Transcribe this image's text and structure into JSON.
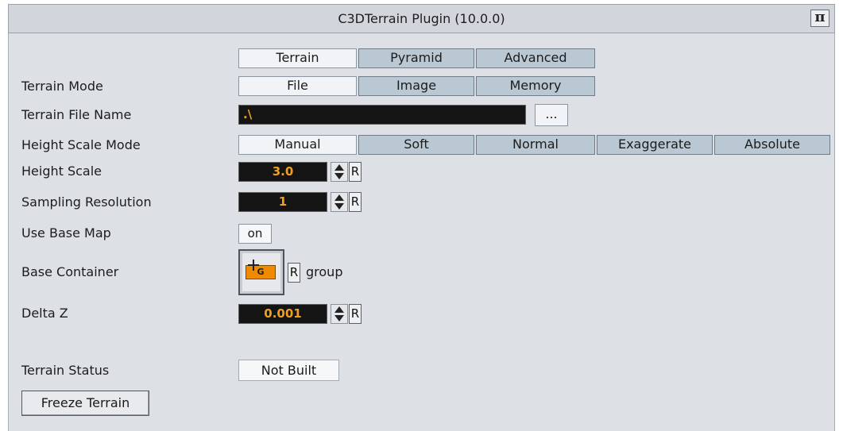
{
  "window": {
    "title": "C3DTerrain Plugin (10.0.0)",
    "plugin_icon": "terrain-plugin-icon"
  },
  "tabs": [
    {
      "label": "Terrain",
      "selected": true
    },
    {
      "label": "Pyramid",
      "selected": false
    },
    {
      "label": "Advanced",
      "selected": false
    }
  ],
  "terrain_mode": {
    "label": "Terrain Mode",
    "options": [
      {
        "label": "File",
        "selected": true
      },
      {
        "label": "Image",
        "selected": false
      },
      {
        "label": "Memory",
        "selected": false
      }
    ]
  },
  "terrain_file": {
    "label": "Terrain File Name",
    "value": ".\\",
    "browse_label": "..."
  },
  "height_scale_mode": {
    "label": "Height Scale Mode",
    "options": [
      {
        "label": "Manual",
        "selected": true
      },
      {
        "label": "Soft",
        "selected": false
      },
      {
        "label": "Normal",
        "selected": false
      },
      {
        "label": "Exaggerate",
        "selected": false
      },
      {
        "label": "Absolute",
        "selected": false
      }
    ]
  },
  "height_scale": {
    "label": "Height Scale",
    "value": "3.0",
    "reset_label": "R"
  },
  "sampling_resolution": {
    "label": "Sampling Resolution",
    "value": "1",
    "reset_label": "R"
  },
  "use_base_map": {
    "label": "Use Base Map",
    "value": "on"
  },
  "base_container": {
    "label": "Base Container",
    "icon_text": "G",
    "reset_label": "R",
    "value": "group"
  },
  "delta_z": {
    "label": "Delta Z",
    "value": "0.001",
    "reset_label": "R"
  },
  "terrain_status": {
    "label": "Terrain Status",
    "value": "Not Built"
  },
  "freeze_button": {
    "label": "Freeze Terrain"
  },
  "colors": {
    "panel": "#dde1e6",
    "button": "#b9c8d3",
    "field_bg": "#141414",
    "field_text": "#f0a020",
    "accent": "#f08a00"
  }
}
